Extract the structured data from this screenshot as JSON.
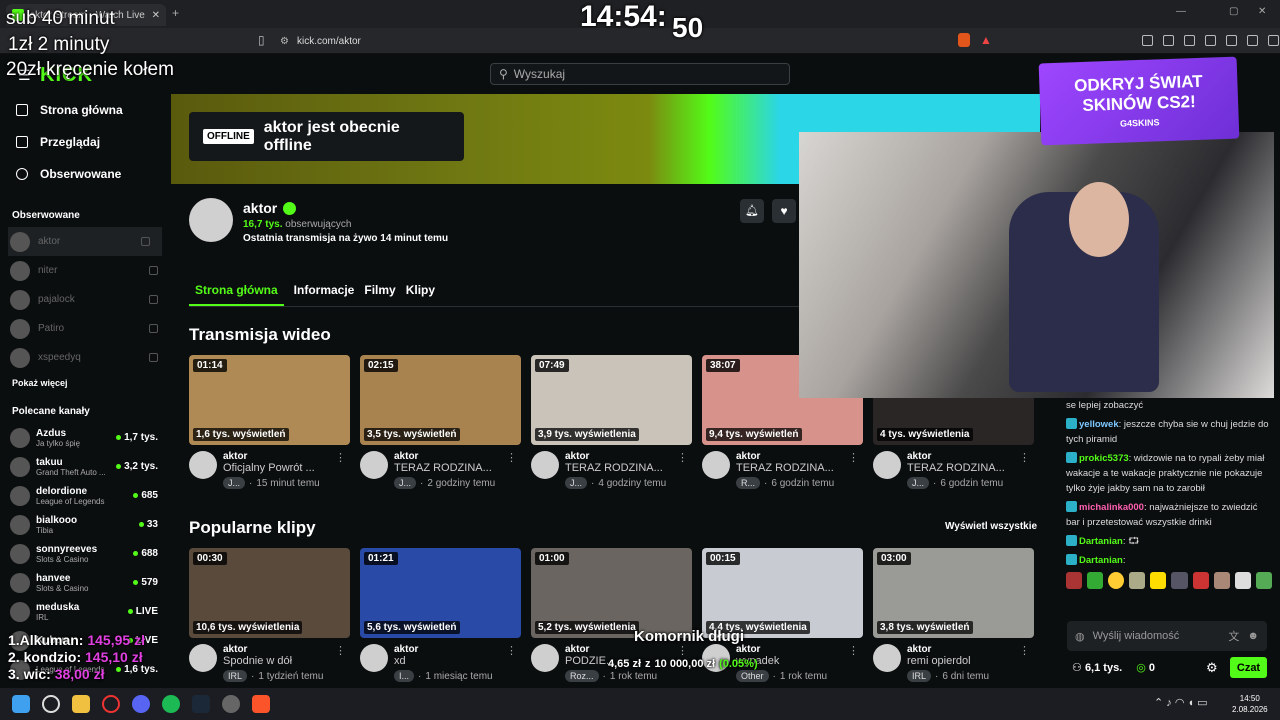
{
  "browser": {
    "tab_title": "aktor Stream - Watch Live on Kick",
    "url": "kick.com/aktor"
  },
  "overlay": {
    "sub": "sub 40 minut",
    "zl2": "1zł 2 minuty",
    "zl20": "20zł kręcenie kołem",
    "clock": "14:54:",
    "clock_sec": "50",
    "leaders": [
      {
        "rank": "1.Alkuman:",
        "amt": "145,95 zł"
      },
      {
        "rank": "2. kondzio:",
        "amt": "145,10 zł"
      },
      {
        "rank": "3. wic:",
        "amt": "38,00 zł"
      }
    ],
    "goal_title": "Komornik długi",
    "goal_cur": "4,65 zł",
    "goal_sep": "z",
    "goal_max": "10 000,00 zł",
    "goal_pct": "(0.05%)"
  },
  "header": {
    "logo": "KICK",
    "search_placeholder": "Wyszukaj"
  },
  "sidebar": {
    "nav": [
      "Strona główna",
      "Przeglądaj",
      "Obserwowane"
    ],
    "following_title": "Obserwowane",
    "following": [
      "aktor",
      "niter",
      "pajalock",
      "Patiro",
      "xspeedyq"
    ],
    "show_more": "Pokaż więcej",
    "recommended_title": "Polecane kanały",
    "recommended": [
      {
        "name": "Azdus",
        "game": "Ja tylko śpię",
        "viewers": "1,7 tys."
      },
      {
        "name": "takuu",
        "game": "Grand Theft Auto ...",
        "viewers": "3,2 tys."
      },
      {
        "name": "delordione",
        "game": "League of Legends",
        "viewers": "685"
      },
      {
        "name": "bialkooo",
        "game": "Tibia",
        "viewers": "33"
      },
      {
        "name": "sonnyreeves",
        "game": "Slots & Casino",
        "viewers": "688"
      },
      {
        "name": "hanvee",
        "game": "Slots & Casino",
        "viewers": "579"
      },
      {
        "name": "meduska",
        "game": "IRL",
        "viewers": "LIVE"
      },
      {
        "name": "Kubon",
        "game": "",
        "viewers": "LIVE"
      },
      {
        "name": "",
        "game": "League of Legends",
        "viewers": "1,6 tys."
      }
    ]
  },
  "banner": {
    "badge": "OFFLINE",
    "text": "aktor jest obecnie offline"
  },
  "channel": {
    "name": "aktor",
    "followers_num": "16,7 tys.",
    "followers_label": "obserwujących",
    "last_live": "Ostatnia transmisja na żywo 14 minut temu"
  },
  "tabs": [
    "Strona główna",
    "Informacje",
    "Filmy",
    "Klipy"
  ],
  "videos_title": "Transmisja wideo",
  "videos": [
    {
      "dur": "01:14",
      "views": "1,6 tys. wyświetleń",
      "title": "Oficjalny Powrót ...",
      "tag": "J...",
      "age": "15 minut temu",
      "bg": "#b08a55"
    },
    {
      "dur": "02:15",
      "views": "3,5 tys. wyświetleń",
      "title": "TERAZ RODZINA...",
      "tag": "J...",
      "age": "2 godziny temu",
      "bg": "#a88350"
    },
    {
      "dur": "07:49",
      "views": "3,9 tys. wyświetlenia",
      "title": "TERAZ RODZINA...",
      "tag": "J...",
      "age": "4 godziny temu",
      "bg": "#c9c3ba"
    },
    {
      "dur": "38:07",
      "views": "9,4 tys. wyświetleń",
      "title": "TERAZ RODZINA...",
      "tag": "R...",
      "age": "6 godzin temu",
      "bg": "#d8928c"
    },
    {
      "dur": "",
      "views": "4 tys. wyświetlenia",
      "title": "TERAZ RODZINA...",
      "tag": "J...",
      "age": "6 godzin temu",
      "bg": "#2a2626"
    }
  ],
  "clips_title": "Popularne klipy",
  "clips_all": "Wyświetl wszystkie",
  "clips": [
    {
      "dur": "00:30",
      "views": "10,6 tys. wyświetlenia",
      "title": "Spodnie w dół",
      "tag": "IRL",
      "age": "1 tydzień temu",
      "bg": "#5a4a3c"
    },
    {
      "dur": "01:21",
      "views": "5,6 tys. wyświetleń",
      "title": "xd",
      "tag": "I...",
      "age": "1 miesiąc temu",
      "bg": "#2a4aa8"
    },
    {
      "dur": "01:00",
      "views": "5,2 tys. wyświetlenia",
      "title": "PODZIE...",
      "tag": "Roz...",
      "age": "1 rok temu",
      "bg": "#6a6560"
    },
    {
      "dur": "00:15",
      "views": "4,4 tys. wyświetlenia",
      "title": "wypadek",
      "tag": "Other",
      "age": "1 rok temu",
      "bg": "#c8ccd2"
    },
    {
      "dur": "03:00",
      "views": "3,8 tys. wyświetleń",
      "title": "remi opierdol",
      "tag": "IRL",
      "age": "6 dni temu",
      "bg": "#9a9a96"
    }
  ],
  "ad": {
    "line1": "ODKRYJ ŚWIAT",
    "line2": "SKINÓW CS2!",
    "brand": "G4SKINS"
  },
  "chat": {
    "msgs": [
      {
        "user": "",
        "text": "se lepiej zobaczyć",
        "color": "#ddd"
      },
      {
        "user": "yellowek",
        "text": ": jeszcze chyba sie w chuj jedzie do tych piramid",
        "color": "#7ec8ff"
      },
      {
        "user": "prokic5373",
        "text": ": widzowie na to rypali żeby miał wakacje a te wakacje praktycznie nie pokazuje tylko żyje jakby sam na to zarobił",
        "color": "#53fc18"
      },
      {
        "user": "michalinka000",
        "text": ": najważniejsze to zwiedzić bar i przetestować wszystkie drinki",
        "color": "#ff5fb0"
      },
      {
        "user": "Dartanian",
        "text": ": ⮔",
        "color": "#53fc18"
      },
      {
        "user": "Dartanian",
        "text": ":",
        "color": "#53fc18"
      }
    ],
    "placeholder": "Wyślij wiadomość",
    "viewers": "6,1 tys.",
    "points": "0",
    "send": "Czat"
  },
  "taskbar": {
    "time": "14:50",
    "date": "2.08.2026"
  },
  "colors": {
    "accent": "#53fc18",
    "bg": "#0b0e0f"
  }
}
